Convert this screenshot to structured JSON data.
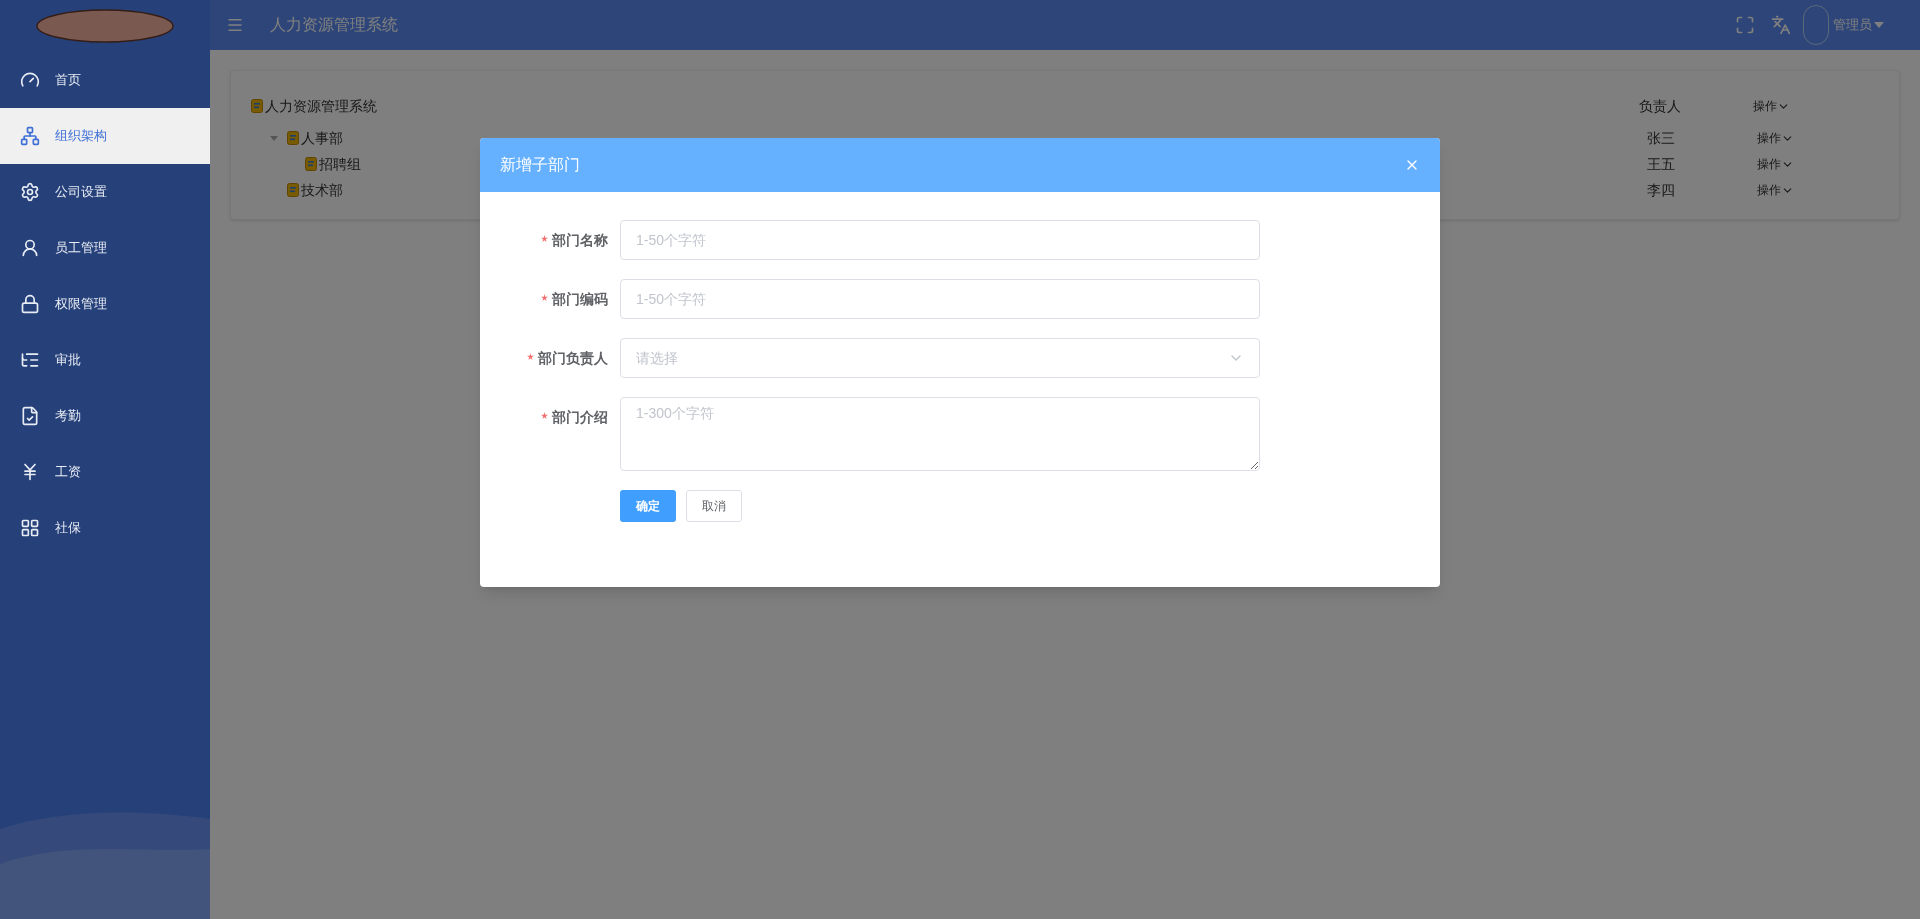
{
  "sidebar": {
    "items": [
      {
        "label": "首页",
        "selected": false
      },
      {
        "label": "组织架构",
        "selected": true
      },
      {
        "label": "公司设置",
        "selected": false
      },
      {
        "label": "员工管理",
        "selected": false
      },
      {
        "label": "权限管理",
        "selected": false
      },
      {
        "label": "审批",
        "selected": false
      },
      {
        "label": "考勤",
        "selected": false
      },
      {
        "label": "工资",
        "selected": false
      },
      {
        "label": "社保",
        "selected": false
      }
    ]
  },
  "header": {
    "title": "人力资源管理系统",
    "user": "管理员"
  },
  "tree": {
    "root": {
      "label": "人力资源管理系统",
      "manager": "负责人",
      "action": "操作"
    },
    "children": [
      {
        "label": "人事部",
        "manager": "张三",
        "action": "操作",
        "expanded": true,
        "children": [
          {
            "label": "招聘组",
            "manager": "王五",
            "action": "操作"
          }
        ]
      },
      {
        "label": "技术部",
        "manager": "李四",
        "action": "操作"
      }
    ]
  },
  "dialog": {
    "title": "新增子部门",
    "fields": [
      {
        "kind": "input",
        "label": "部门名称",
        "required": true,
        "placeholder": "1-50个字符"
      },
      {
        "kind": "input",
        "label": "部门编码",
        "required": true,
        "placeholder": "1-50个字符"
      },
      {
        "kind": "select",
        "label": "部门负责人",
        "required": true,
        "placeholder": "请选择"
      },
      {
        "kind": "textarea",
        "label": "部门介绍",
        "required": true,
        "placeholder": "1-300个字符"
      }
    ],
    "buttons": [
      {
        "label": "确定",
        "kind": "primary"
      },
      {
        "label": "取消",
        "kind": "default"
      }
    ]
  }
}
